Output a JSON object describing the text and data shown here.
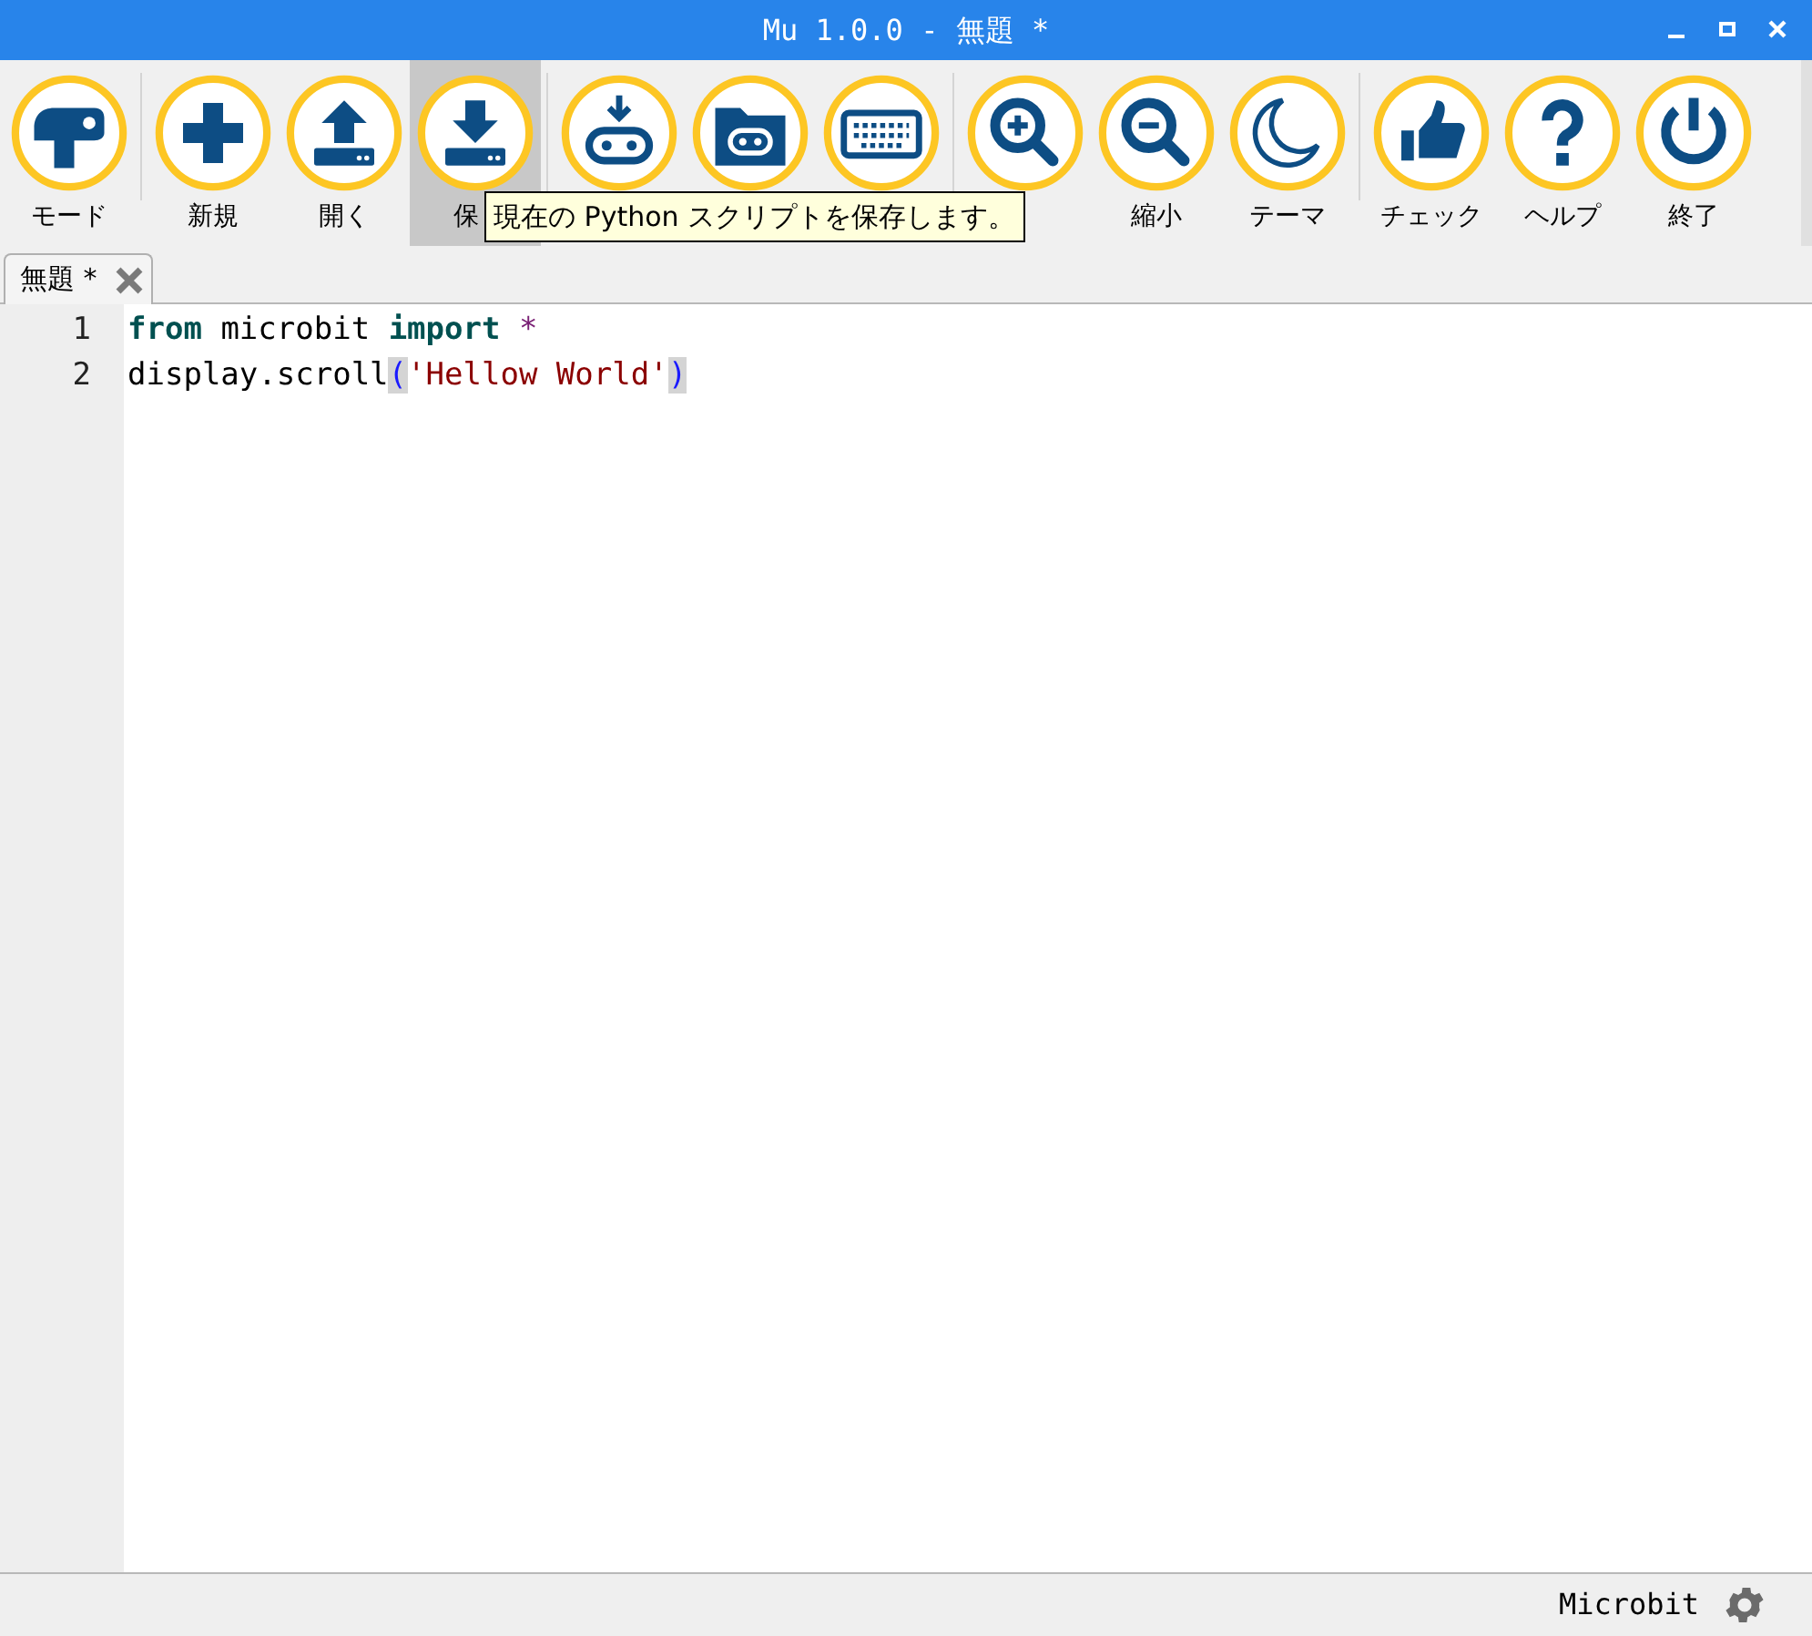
{
  "window": {
    "title": "Mu 1.0.0 - 無題 *"
  },
  "toolbar": [
    {
      "kind": "mode",
      "label": "モード",
      "hovered": false,
      "group_start": false
    },
    {
      "kind": "new",
      "label": "新規",
      "hovered": false,
      "group_start": true
    },
    {
      "kind": "load",
      "label": "開く",
      "hovered": false,
      "group_start": false
    },
    {
      "kind": "save",
      "label": "保",
      "hovered": true,
      "group_start": false
    },
    {
      "kind": "flash",
      "hovered": false,
      "group_start": true
    },
    {
      "kind": "files",
      "hovered": false,
      "group_start": false
    },
    {
      "kind": "repl",
      "hovered": false,
      "group_start": false
    },
    {
      "kind": "zoom-in",
      "hovered": false,
      "group_start": true
    },
    {
      "kind": "zoom-out",
      "label": "縮小",
      "hovered": false,
      "group_start": false
    },
    {
      "kind": "theme",
      "label": "テーマ",
      "hovered": false,
      "group_start": false
    },
    {
      "kind": "check",
      "label": "チェック",
      "hovered": false,
      "group_start": true
    },
    {
      "kind": "help",
      "label": "ヘルプ",
      "hovered": false,
      "group_start": false
    },
    {
      "kind": "quit",
      "label": "終了",
      "hovered": false,
      "group_start": false
    }
  ],
  "tooltip": "現在の Python スクリプトを保存します。",
  "tabs": [
    {
      "label": "無題 *",
      "selected": true
    }
  ],
  "editor": {
    "lines": [
      {
        "number": "1",
        "tokens": [
          {
            "kind": "keyword",
            "text": "from"
          },
          {
            "kind": "plain",
            "text": " microbit "
          },
          {
            "kind": "keyword",
            "text": "import"
          },
          {
            "kind": "operator",
            "text": " *"
          }
        ]
      },
      {
        "number": "2",
        "tokens": [
          {
            "kind": "plain",
            "text": "display.scroll"
          },
          {
            "kind": "brace",
            "text": "("
          },
          {
            "kind": "string",
            "text": "'Hellow World'"
          },
          {
            "kind": "brace",
            "text": ")"
          }
        ]
      }
    ]
  },
  "status_bar": {
    "mode": "Microbit"
  }
}
